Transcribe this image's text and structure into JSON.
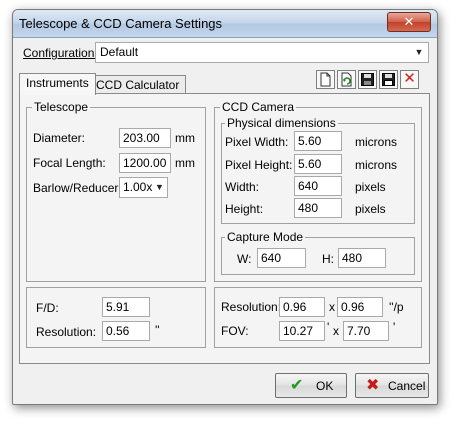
{
  "window": {
    "title": "Telescope & CCD Camera Settings",
    "close_glyph": "✕"
  },
  "configuration": {
    "label": "Configuration:",
    "value": "Default"
  },
  "tabs": [
    {
      "label": "Instruments",
      "active": true
    },
    {
      "label": "CCD Calculator",
      "active": false
    }
  ],
  "toolbar": {
    "icons": [
      "new-document-icon",
      "refresh-document-icon",
      "save-icon",
      "save-all-icon",
      "delete-icon"
    ],
    "delete_glyph": "✕"
  },
  "telescope": {
    "group_label": "Telescope",
    "diameter": {
      "label": "Diameter:",
      "value": "203.00",
      "unit": "mm"
    },
    "focal_length": {
      "label": "Focal Length:",
      "value": "1200.00",
      "unit": "mm"
    },
    "barlow": {
      "label": "Barlow/Reducer:",
      "value": "1.00x"
    }
  },
  "telescope_results": {
    "fd": {
      "label": "F/D:",
      "value": "5.91"
    },
    "resolution": {
      "label": "Resolution:",
      "value": "0.56",
      "unit": "''"
    }
  },
  "ccd": {
    "group_label": "CCD Camera",
    "physical": {
      "group_label": "Physical dimensions",
      "pixel_width": {
        "label": "Pixel Width:",
        "value": "5.60",
        "unit": "microns"
      },
      "pixel_height": {
        "label": "Pixel Height:",
        "value": "5.60",
        "unit": "microns"
      },
      "width": {
        "label": "Width:",
        "value": "640",
        "unit": "pixels"
      },
      "height": {
        "label": "Height:",
        "value": "480",
        "unit": "pixels"
      }
    },
    "capture_mode": {
      "group_label": "Capture Mode",
      "w": {
        "label": "W:",
        "value": "640"
      },
      "h": {
        "label": "H:",
        "value": "480"
      }
    }
  },
  "ccd_results": {
    "resolution": {
      "label": "Resolution:",
      "x": "0.96",
      "sep": "x",
      "y": "0.96",
      "unit": "''/p"
    },
    "fov": {
      "label": "FOV:",
      "x": "10.27",
      "x_unit": "'",
      "sep": "x",
      "y": "7.70",
      "y_unit": "'"
    }
  },
  "buttons": {
    "ok": "OK",
    "cancel": "Cancel"
  },
  "colors": {
    "ok_check": "#1f9b1f",
    "cancel_x": "#c61a1a",
    "delete_x": "#d42020",
    "group_border": "#a0a0a0"
  }
}
